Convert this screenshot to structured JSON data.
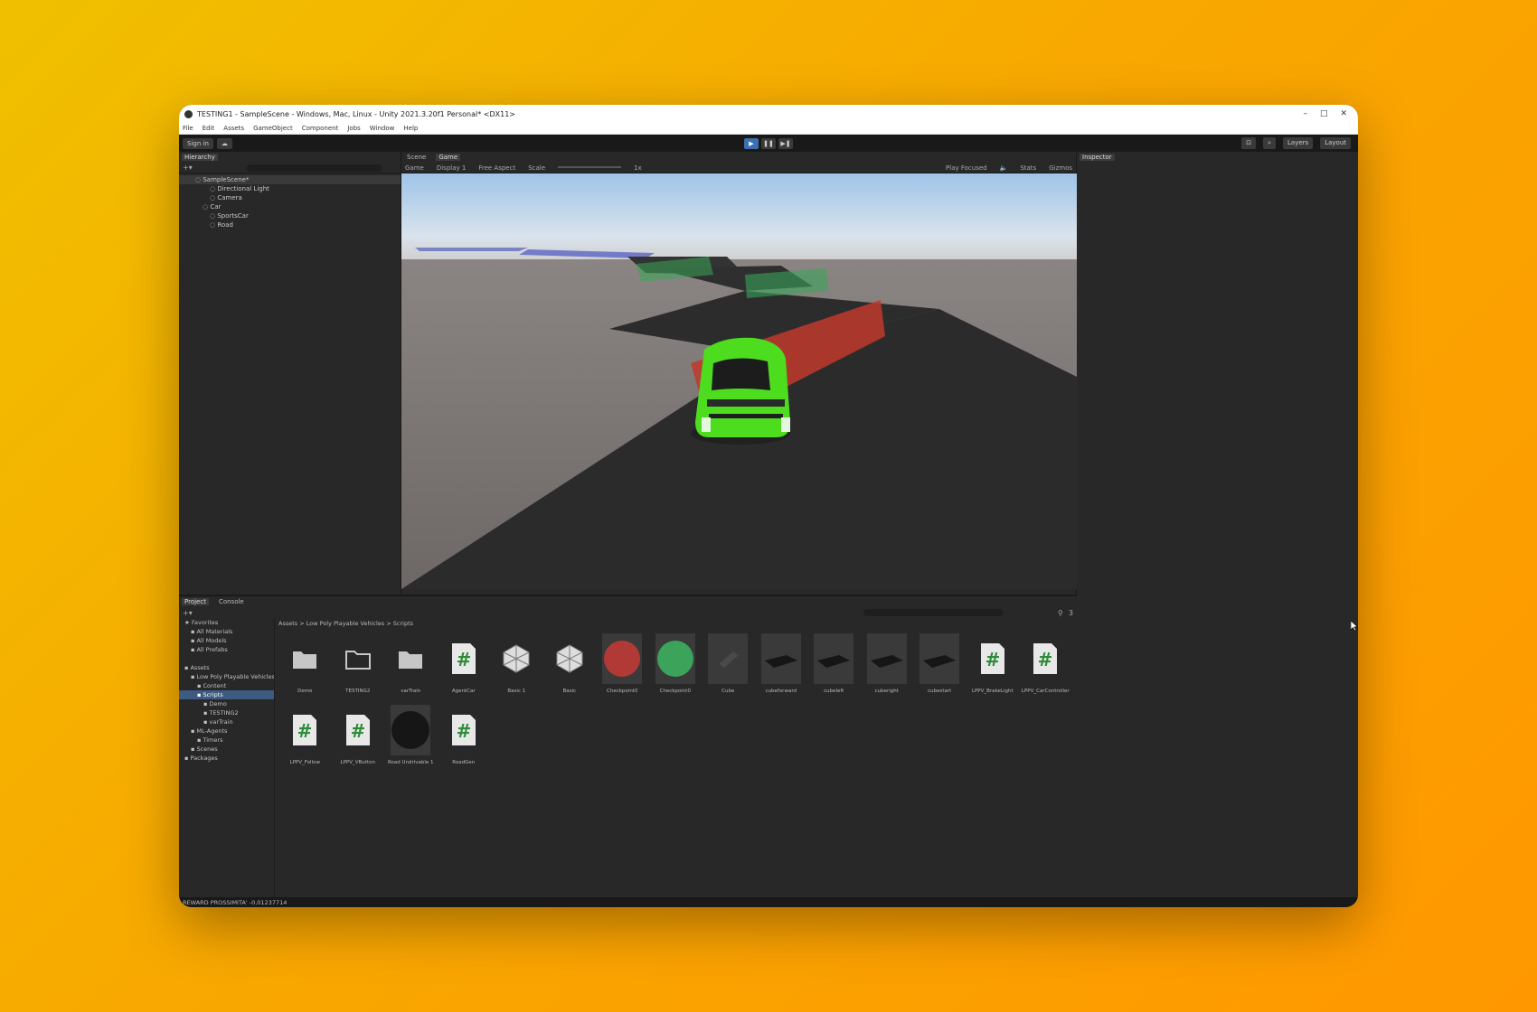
{
  "window": {
    "title": "TESTING1 - SampleScene - Windows, Mac, Linux - Unity 2021.3.20f1 Personal* <DX11>",
    "controls": [
      "–",
      "□",
      "✕"
    ]
  },
  "menu": [
    "File",
    "Edit",
    "Assets",
    "GameObject",
    "Component",
    "Jobs",
    "Window",
    "Help"
  ],
  "toolbar": {
    "sign_in": "Sign in",
    "layers": "Layers",
    "layout": "Layout"
  },
  "hierarchy": {
    "tab": "Hierarchy",
    "search_placeholder": "All",
    "items": [
      {
        "label": "SampleScene*",
        "indent": 0
      },
      {
        "label": "Directional Light",
        "indent": 2
      },
      {
        "label": "Camera",
        "indent": 2
      },
      {
        "label": "Car",
        "indent": 1
      },
      {
        "label": "SportsCar",
        "indent": 2
      },
      {
        "label": "Road",
        "indent": 2
      }
    ]
  },
  "game": {
    "tabs": [
      "Scene",
      "Game"
    ],
    "active_tab": "Game",
    "display_mode": "Game",
    "display": "Display 1",
    "aspect": "Free Aspect",
    "scale_label": "Scale",
    "scale_value": "1x",
    "play_focused": "Play Focused",
    "stats": "Stats",
    "gizmos": "Gizmos"
  },
  "inspector": {
    "tab": "Inspector"
  },
  "project": {
    "tabs": [
      "Project",
      "Console"
    ],
    "tree": [
      {
        "label": "Favorites",
        "indent": 0
      },
      {
        "label": "All Materials",
        "indent": 1
      },
      {
        "label": "All Models",
        "indent": 1
      },
      {
        "label": "All Prefabs",
        "indent": 1
      },
      {
        "label": "",
        "indent": 0
      },
      {
        "label": "Assets",
        "indent": 0
      },
      {
        "label": "Low Poly Playable Vehicles",
        "indent": 1
      },
      {
        "label": "Content",
        "indent": 2
      },
      {
        "label": "Scripts",
        "indent": 2
      },
      {
        "label": "Demo",
        "indent": 3
      },
      {
        "label": "TESTING2",
        "indent": 3
      },
      {
        "label": "varTrain",
        "indent": 3
      },
      {
        "label": "ML-Agents",
        "indent": 1
      },
      {
        "label": "Timers",
        "indent": 2
      },
      {
        "label": "Scenes",
        "indent": 1
      },
      {
        "label": "Packages",
        "indent": 0
      }
    ],
    "breadcrumb": [
      "Assets",
      "Low Poly Playable Vehicles",
      "Scripts"
    ],
    "assets": [
      {
        "name": "Demo",
        "kind": "folder"
      },
      {
        "name": "TESTING2",
        "kind": "folder-open"
      },
      {
        "name": "varTrain",
        "kind": "folder"
      },
      {
        "name": "AgentCar",
        "kind": "script"
      },
      {
        "name": "Basic 1",
        "kind": "model"
      },
      {
        "name": "Basic",
        "kind": "model"
      },
      {
        "name": "Checkpoint0",
        "kind": "sphere-red"
      },
      {
        "name": "Checkpoint0 ",
        "kind": "sphere-green"
      },
      {
        "name": "Cube",
        "kind": "cube"
      },
      {
        "name": "cubeforward",
        "kind": "plane"
      },
      {
        "name": "cubeleft",
        "kind": "plane"
      },
      {
        "name": "cuberight",
        "kind": "plane"
      },
      {
        "name": "cubestart",
        "kind": "plane"
      },
      {
        "name": "LPPV_BrakeLight",
        "kind": "script"
      },
      {
        "name": "LPPV_CarController",
        "kind": "script"
      },
      {
        "name": "LPPV_Follow",
        "kind": "script"
      },
      {
        "name": "LPPV_VButton",
        "kind": "script"
      },
      {
        "name": "Road Undrivable 1",
        "kind": "sphere-dark"
      },
      {
        "name": "RoadGen",
        "kind": "script"
      }
    ],
    "count_badge": "3"
  },
  "status": {
    "message": "REWARD PROSSIMITA' -0,01237714"
  },
  "colors": {
    "play_active": "#3b6fb0",
    "script_hash": "#2e8b3a",
    "checkpoint_red": "#c0392b",
    "checkpoint_green": "#3ba35a"
  }
}
